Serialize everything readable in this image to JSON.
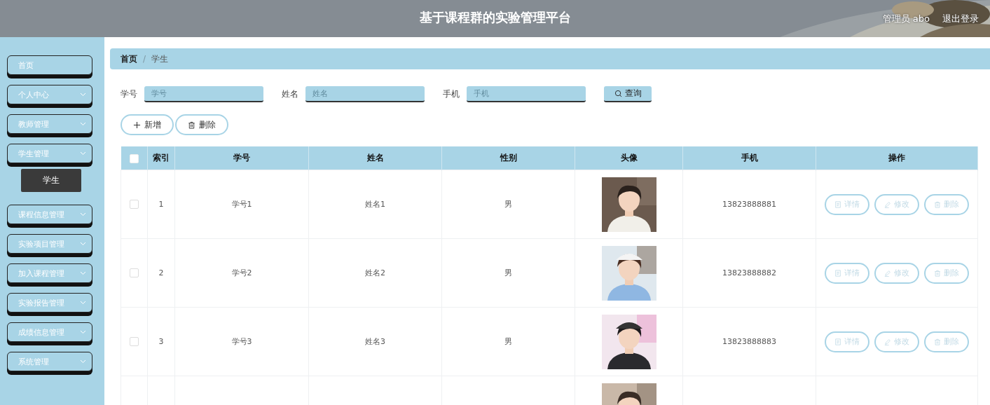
{
  "header": {
    "title": "基于课程群的实验管理平台",
    "user": "管理员 abo",
    "logout": "退出登录",
    "background": {
      "kind": "picture"
    }
  },
  "sidebar": {
    "items": [
      {
        "label": "首页",
        "has_caret": false
      },
      {
        "label": "个人中心",
        "has_caret": true
      },
      {
        "label": "教师管理",
        "has_caret": true
      },
      {
        "label": "学生管理",
        "has_caret": true,
        "children": [
          {
            "label": "学生"
          }
        ]
      },
      {
        "label": "课程信息管理",
        "has_caret": true
      },
      {
        "label": "实验项目管理",
        "has_caret": true
      },
      {
        "label": "加入课程管理",
        "has_caret": true
      },
      {
        "label": "实验报告管理",
        "has_caret": true
      },
      {
        "label": "成绩信息管理",
        "has_caret": true
      },
      {
        "label": "系统管理",
        "has_caret": true
      }
    ]
  },
  "breadcrumb": [
    "首页",
    "学生"
  ],
  "breadcrumb_separator": "/",
  "search": {
    "fields": [
      {
        "label": "学号",
        "placeholder": "学号"
      },
      {
        "label": "姓名",
        "placeholder": "姓名"
      },
      {
        "label": "手机",
        "placeholder": "手机"
      }
    ],
    "button": "查询"
  },
  "actions": [
    {
      "kind": "add",
      "label": "新增"
    },
    {
      "kind": "delete",
      "label": "删除"
    }
  ],
  "table": {
    "select_all_checked": false,
    "columns": [
      "索引",
      "学号",
      "姓名",
      "性别",
      "头像",
      "手机",
      "操作"
    ],
    "rows": [
      {
        "checked": false,
        "index": "1",
        "student_id": "学号1",
        "name": "姓名1",
        "gender": "男",
        "avatar": {
          "kind": "picture"
        },
        "phone": "13823888881",
        "buttons": [
          {
            "kind": "detail",
            "label": "详情"
          },
          {
            "kind": "edit",
            "label": "修改"
          },
          {
            "kind": "delete",
            "label": "删除"
          }
        ]
      },
      {
        "checked": false,
        "index": "2",
        "student_id": "学号2",
        "name": "姓名2",
        "gender": "男",
        "avatar": {
          "kind": "picture"
        },
        "phone": "13823888882",
        "buttons": [
          {
            "kind": "detail",
            "label": "详情"
          },
          {
            "kind": "edit",
            "label": "修改"
          },
          {
            "kind": "delete",
            "label": "删除"
          }
        ]
      },
      {
        "checked": false,
        "index": "3",
        "student_id": "学号3",
        "name": "姓名3",
        "gender": "男",
        "avatar": {
          "kind": "picture"
        },
        "phone": "13823888883",
        "buttons": [
          {
            "kind": "detail",
            "label": "详情"
          },
          {
            "kind": "edit",
            "label": "修改"
          },
          {
            "kind": "delete",
            "label": "删除"
          }
        ]
      },
      {
        "avatar": {
          "kind": "picture"
        }
      }
    ]
  }
}
